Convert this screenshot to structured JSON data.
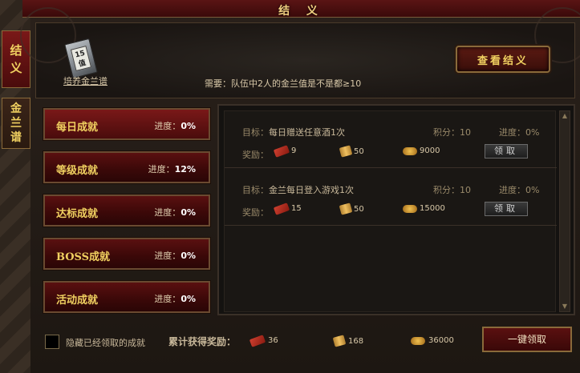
{
  "window": {
    "title": "结 义"
  },
  "side_tabs": [
    {
      "label": "结\n义"
    },
    {
      "label": "金\n兰\n谱"
    }
  ],
  "header": {
    "book_badge": "15值",
    "book_label": "培养金兰谱",
    "need_text": "需要：队伍中2人的金兰值是不是都≥10",
    "view_button": "查看结义"
  },
  "categories": [
    {
      "name": "每日成就",
      "progress_label": "进度：",
      "progress": "0%"
    },
    {
      "name": "等级成就",
      "progress_label": "进度：",
      "progress": "12%"
    },
    {
      "name": "达标成就",
      "progress_label": "进度：",
      "progress": "0%"
    },
    {
      "name": "BOSS成就",
      "progress_label": "进度：",
      "progress": "0%"
    },
    {
      "name": "活动成就",
      "progress_label": "进度：",
      "progress": "0%"
    }
  ],
  "tasks": [
    {
      "goal_label": "目标：",
      "goal": "每日赠送任意酒1次",
      "score_label": "积分：",
      "score": "10",
      "progress_label": "进度：",
      "progress": "0%",
      "reward_label": "奖励：",
      "rewards": [
        "9",
        "50",
        "9000"
      ],
      "claim": "领取"
    },
    {
      "goal_label": "目标：",
      "goal": "金兰每日登入游戏1次",
      "score_label": "积分：",
      "score": "10",
      "progress_label": "进度：",
      "progress": "0%",
      "reward_label": "奖励：",
      "rewards": [
        "15",
        "50",
        "15000"
      ],
      "claim": "领取"
    }
  ],
  "footer": {
    "hide_claimed": "隐藏已经领取的成就",
    "total_label": "累计获得奖励：",
    "totals": [
      "36",
      "168",
      "36000"
    ],
    "one_key": "一键领取"
  },
  "icons": {
    "reward1": "lure-icon",
    "reward2": "scroll-icon",
    "reward3": "gold-ingot-icon"
  }
}
